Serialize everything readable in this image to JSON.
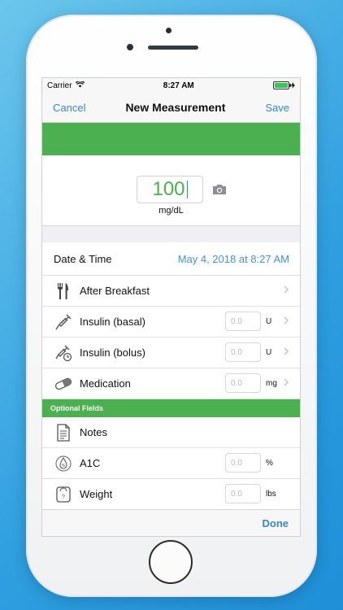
{
  "status_bar": {
    "carrier": "Carrier",
    "time": "8:27 AM"
  },
  "nav": {
    "cancel_label": "Cancel",
    "title": "New Measurement",
    "save_label": "Save"
  },
  "measurement": {
    "value": "100",
    "unit": "mg/dL"
  },
  "datetime": {
    "label": "Date & Time",
    "value": "May 4, 2018 at 8:27 AM"
  },
  "rows": [
    {
      "label": "After Breakfast",
      "icon": "fork-knife-icon"
    },
    {
      "label": "Insulin (basal)",
      "icon": "syringe-icon",
      "placeholder": "0.0",
      "unit": "U"
    },
    {
      "label": "Insulin (bolus)",
      "icon": "syringe-clock-icon",
      "placeholder": "0.0",
      "unit": "U"
    },
    {
      "label": "Medication",
      "icon": "pill-icon",
      "placeholder": "0.0",
      "unit": "mg"
    }
  ],
  "optional_section": {
    "title": "Optional Fields"
  },
  "optional_rows": [
    {
      "label": "Notes",
      "icon": "notes-icon"
    },
    {
      "label": "A1C",
      "icon": "drop-percent-icon",
      "placeholder": "0.0",
      "unit": "%"
    },
    {
      "label": "Weight",
      "icon": "scale-icon",
      "placeholder": "0.0",
      "unit": "lbs"
    }
  ],
  "toolbar": {
    "done_label": "Done"
  },
  "colors": {
    "accent_green": "#4caf50",
    "link_blue": "#3a86c9",
    "date_blue": "#4a90d9",
    "background": "#efeff4"
  }
}
